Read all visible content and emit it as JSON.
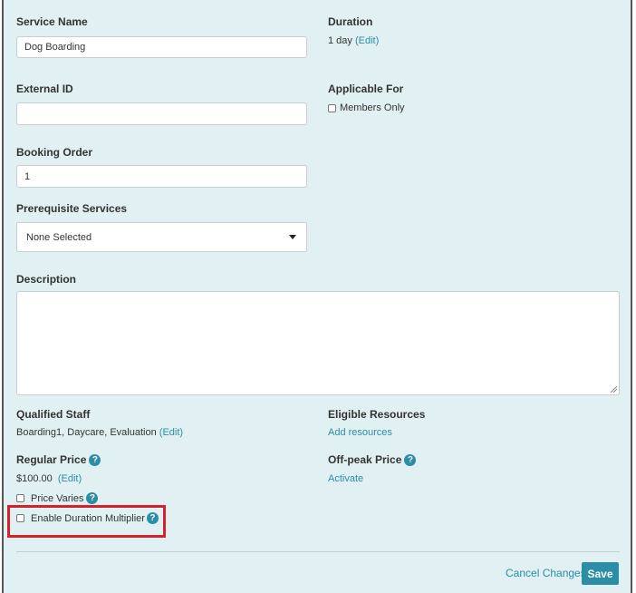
{
  "form": {
    "service_name": {
      "label": "Service Name",
      "value": "Dog Boarding"
    },
    "duration": {
      "label": "Duration",
      "value": "1 day",
      "edit": "(Edit)"
    },
    "external_id": {
      "label": "External ID",
      "value": ""
    },
    "applicable_for": {
      "label": "Applicable For",
      "members_only": "Members Only"
    },
    "booking_order": {
      "label": "Booking Order",
      "value": "1"
    },
    "prerequisite": {
      "label": "Prerequisite Services",
      "selected": "None Selected"
    },
    "description": {
      "label": "Description",
      "value": ""
    },
    "qualified_staff": {
      "label": "Qualified Staff",
      "value": "Boarding1, Daycare, Evaluation",
      "edit": "(Edit)"
    },
    "eligible_resources": {
      "label": "Eligible Resources",
      "add": "Add resources"
    },
    "regular_price": {
      "label": "Regular Price",
      "value": "$100.00",
      "edit": "(Edit)"
    },
    "offpeak_price": {
      "label": "Off-peak Price",
      "activate": "Activate"
    },
    "price_varies": "Price Varies",
    "duration_multiplier": "Enable Duration Multiplier",
    "help_glyph": "?"
  },
  "footer": {
    "cancel": "Cancel Changes",
    "save": "Save"
  },
  "colors": {
    "background": "#e1f0f2",
    "link": "#2b8ea6",
    "highlight": "#d2232a"
  }
}
